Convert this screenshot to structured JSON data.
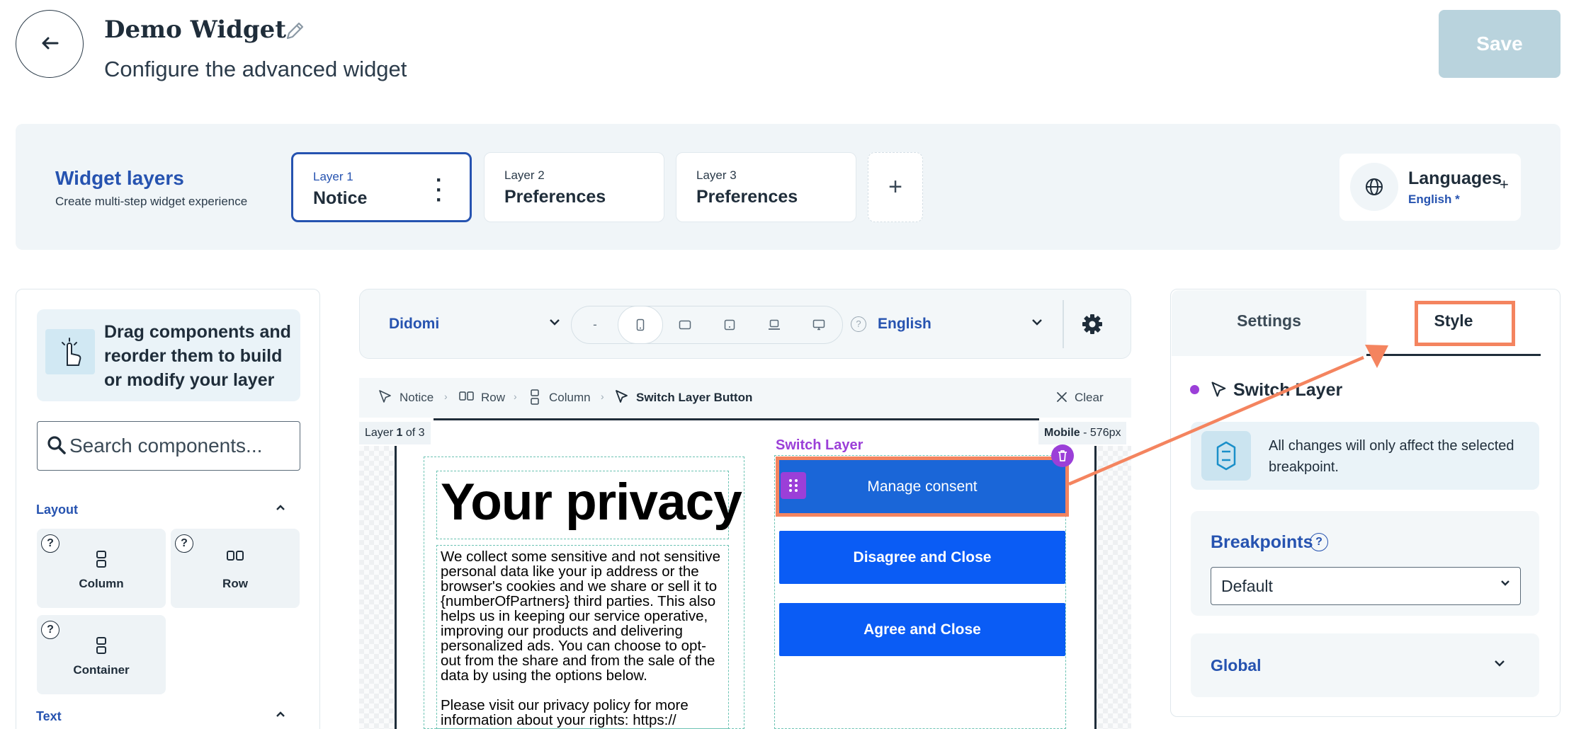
{
  "header": {
    "title": "Demo Widget",
    "subtitle": "Configure the advanced widget",
    "save_label": "Save",
    "back_icon": "arrow-left-icon"
  },
  "layers": {
    "title": "Widget layers",
    "subtitle": "Create multi-step widget experience",
    "items": [
      {
        "small": "Layer 1",
        "name": "Notice",
        "active": true
      },
      {
        "small": "Layer 2",
        "name": "Preferences",
        "active": false
      },
      {
        "small": "Layer 3",
        "name": "Preferences",
        "active": false
      }
    ],
    "add_label": "+",
    "languages": {
      "title": "Languages",
      "value": "English",
      "marker": "*",
      "plus": "+"
    }
  },
  "components": {
    "drag_hint": "Drag components and reorder them to build or modify your layer",
    "search_placeholder": "Search components...",
    "sections": [
      {
        "title": "Layout",
        "expanded": true,
        "items": [
          "Column",
          "Row",
          "Container"
        ]
      },
      {
        "title": "Text",
        "expanded": true,
        "items": []
      }
    ],
    "help": "?"
  },
  "toolbar": {
    "vendor": "Didomi",
    "devices": [
      "-",
      "mobile",
      "tablet-landscape",
      "tablet",
      "laptop",
      "desktop"
    ],
    "help": "?",
    "language": "English"
  },
  "breadcrumb": {
    "items": [
      "Notice",
      "Row",
      "Column",
      "Switch Layer Button"
    ],
    "clear_label": "Clear"
  },
  "canvas": {
    "layer_prefix": "Layer",
    "layer_number": "1",
    "layer_suffix": "of 3",
    "breakpoint_bold": "Mobile",
    "breakpoint_rest": " - 576px",
    "privacy_title": "Your privacy",
    "privacy_body": "We collect some sensitive and not sensitive personal data like your ip address or the browser's cookies and we share or sell it to {numberOfPartners} third parties. This also helps us in keeping our service operative, improving our products and delivering personalized ads. You can choose to opt-out from the share and from the sale of the data by using the options below.",
    "privacy_body2": "Please visit our privacy policy for more information about your rights: https://",
    "switch_label": "Switch Layer",
    "buttons": {
      "manage": "Manage consent",
      "disagree": "Disagree and Close",
      "agree": "Agree and Close"
    },
    "colors": {
      "button_blue": "#0a5cf5",
      "selection": "#9b3fd8",
      "highlight": "#f4845f"
    }
  },
  "panel": {
    "tabs": [
      "Settings",
      "Style"
    ],
    "active_tab": "Style",
    "component_title": "Switch Layer",
    "info": "All changes will only affect the selected breakpoint.",
    "breakpoints_label": "Breakpoints",
    "breakpoints_help": "?",
    "breakpoint_value": "Default",
    "global_label": "Global"
  }
}
